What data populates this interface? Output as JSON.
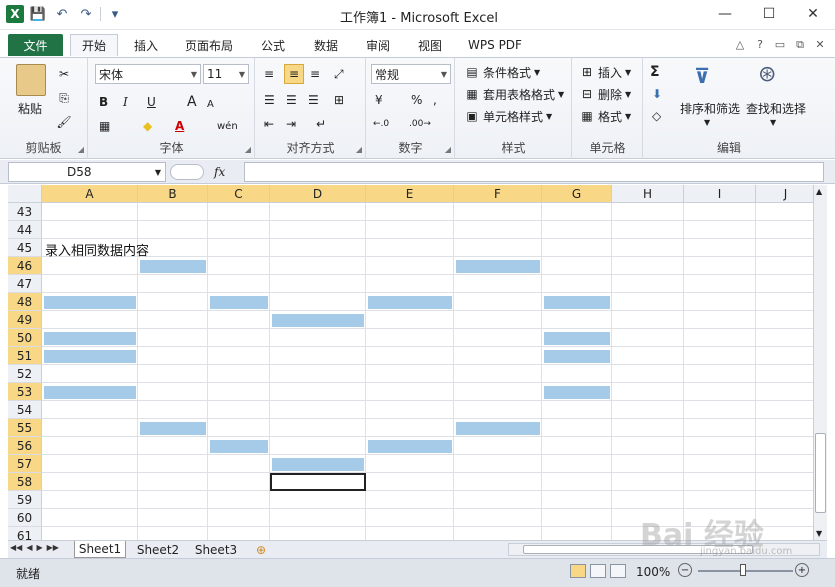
{
  "window": {
    "title": "工作簿1 - Microsoft Excel",
    "logo": "X",
    "minimize": "—",
    "maximize": "☐",
    "close": "✕"
  },
  "quick_access": {
    "save_icon": "💾",
    "undo_icon": "↶",
    "redo_icon": "↷",
    "customize_icon": "▾"
  },
  "tabs": [
    "文件",
    "开始",
    "插入",
    "页面布局",
    "公式",
    "数据",
    "审阅",
    "视图",
    "WPS PDF"
  ],
  "tabs_right_icons": [
    "△",
    "?",
    "▭",
    "⧉",
    "✕"
  ],
  "ribbon": {
    "clipboard": {
      "label": "剪贴板",
      "paste": "粘贴",
      "cut_icon": "✂",
      "copy_icon": "⎘",
      "format_painter_icon": "🖌"
    },
    "font": {
      "label": "字体",
      "font_name": "宋体",
      "font_size": "11",
      "bold": "B",
      "italic": "I",
      "underline": "U",
      "grow": "A",
      "shrink": "A",
      "border_icon": "▦",
      "fill_icon": "◆",
      "font_color": "A",
      "phonetic": "wén"
    },
    "alignment": {
      "label": "对齐方式"
    },
    "number": {
      "label": "数字",
      "format": "常规",
      "currency_icon": "¥",
      "percent": "%",
      "comma": ",",
      "inc_decimal": "←.0",
      "dec_decimal": ".00→"
    },
    "styles": {
      "label": "样式",
      "conditional": "条件格式",
      "table": "套用表格格式",
      "cell_styles": "单元格样式"
    },
    "cells": {
      "label": "单元格",
      "insert": "插入",
      "delete": "删除",
      "format": "格式"
    },
    "editing": {
      "label": "编辑",
      "sum_icon": "Σ",
      "fill_icon": "⬇",
      "clear_icon": "◇",
      "sort": "排序和筛选",
      "find": "查找和选择"
    }
  },
  "formula_bar": {
    "name_box": "D58",
    "fx": "fx",
    "formula": ""
  },
  "grid": {
    "columns": [
      "A",
      "B",
      "C",
      "D",
      "E",
      "F",
      "G",
      "H",
      "I",
      "J"
    ],
    "rows": [
      "43",
      "44",
      "45",
      "46",
      "47",
      "48",
      "49",
      "50",
      "51",
      "52",
      "53",
      "54",
      "55",
      "56",
      "57",
      "58",
      "59",
      "60",
      "61"
    ],
    "selected_columns": [
      "A",
      "B",
      "C",
      "D",
      "E",
      "F",
      "G"
    ],
    "selected_rows": [
      "46",
      "48",
      "49",
      "50",
      "51",
      "53",
      "55",
      "56",
      "57",
      "58"
    ],
    "active_cell": "D58",
    "cell_text": {
      "ref": "A45",
      "value": "录入相同数据内容"
    },
    "highlighted_cells": [
      "B46",
      "F46",
      "A48",
      "C48",
      "E48",
      "G48",
      "D49",
      "A50",
      "G50",
      "A51",
      "G51",
      "A53",
      "G53",
      "B55",
      "F55",
      "C56",
      "E56",
      "D57"
    ],
    "highlight_color": "#a6cbe9"
  },
  "sheets": {
    "tabs": [
      "Sheet1",
      "Sheet2",
      "Sheet3"
    ],
    "active": "Sheet1",
    "new_sheet_icon": "⊕"
  },
  "status": {
    "text": "就绪",
    "zoom": "100%",
    "zoom_minus": "−",
    "zoom_plus": "+"
  },
  "watermark": {
    "text": "Bai 经验",
    "sub": "jingyan.baidu.com"
  }
}
